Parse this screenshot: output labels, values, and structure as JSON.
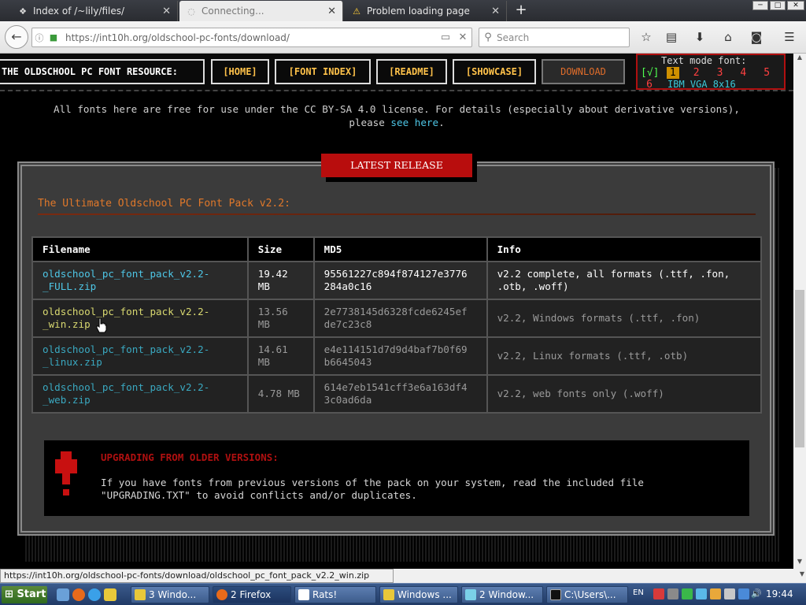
{
  "tabs": [
    {
      "title": "Index of /~lily/files/",
      "icon": "page-icon"
    },
    {
      "title": "Connecting...",
      "icon": "loading-icon"
    },
    {
      "title": "Problem loading page",
      "icon": "warning-icon"
    }
  ],
  "navbar": {
    "url_domain": "https://int10h.org",
    "url_path": "/oldschool-pc-fonts/download/",
    "search_placeholder": "Search"
  },
  "site": {
    "title": "THE OLDSCHOOL PC FONT RESOURCE:",
    "nav": [
      "[HOME]",
      "[FONT INDEX]",
      "[README]",
      "[SHOWCASE]",
      "DOWNLOAD"
    ],
    "font_selector": {
      "label": "Text mode font:",
      "check": "[√]",
      "options": [
        "1",
        "2",
        "3",
        "4",
        "5",
        "6"
      ],
      "current": "IBM VGA 8x16"
    },
    "license_line1": "All fonts here are free for use under the CC BY-SA 4.0 license. For details (especially about derivative versions),",
    "license_line2_prefix": "please ",
    "license_link": "see here",
    "license_line2_suffix": "."
  },
  "release": {
    "badge": "LATEST RELEASE",
    "pack_title": "The Ultimate Oldschool PC Font Pack v2.2:",
    "columns": [
      "Filename",
      "Size",
      "MD5",
      "Info"
    ],
    "rows": [
      {
        "filename_1": "oldschool_pc_font_pack_v2.2-",
        "filename_2": "_FULL.zip",
        "size_1": "19.42",
        "size_2": "MB",
        "md5_1": "95561227c894f874127e3776",
        "md5_2": "284a0c16",
        "info_1": "v2.2 complete, all formats (.ttf, .fon,",
        "info_2": ".otb, .woff)"
      },
      {
        "filename_1": "oldschool_pc_font_pack_v2.2-",
        "filename_2": "_win.zip",
        "size_1": "13.56",
        "size_2": "MB",
        "md5_1": "2e7738145d6328fcde6245ef",
        "md5_2": "de7c23c8",
        "info_1": "v2.2, Windows formats (.ttf, .fon)",
        "info_2": ""
      },
      {
        "filename_1": "oldschool_pc_font_pack_v2.2-",
        "filename_2": "_linux.zip",
        "size_1": "14.61",
        "size_2": "MB",
        "md5_1": "e4e114151d7d9d4baf7b0f69",
        "md5_2": "b6645043",
        "info_1": "v2.2, Linux formats (.ttf, .otb)",
        "info_2": ""
      },
      {
        "filename_1": "oldschool_pc_font_pack_v2.2-",
        "filename_2": "_web.zip",
        "size_1": "4.78 MB",
        "size_2": "",
        "md5_1": "614e7eb1541cff3e6a163df4",
        "md5_2": "3c0ad6da",
        "info_1": "v2.2, web fonts only (.woff)",
        "info_2": ""
      }
    ],
    "upgrade_title": "UPGRADING FROM OLDER VERSIONS:",
    "upgrade_line1": "If you have fonts from previous versions of the pack on your system, read the included file",
    "upgrade_line2": "\"UPGRADING.TXT\" to avoid conflicts and/or duplicates."
  },
  "status_url": "https://int10h.org/oldschool-pc-fonts/download/oldschool_pc_font_pack_v2.2_win.zip",
  "taskbar": {
    "start": "Start",
    "tasks": [
      "3 Windo...",
      "2 Firefox",
      "Rats!",
      "Windows ...",
      "2 Window...",
      "C:\\Users\\..."
    ],
    "lang": "EN",
    "clock": "19:44"
  },
  "colors": {
    "accent_red": "#b80d0d",
    "link_cyan": "#4ec6e6",
    "nav_yellow": "#ffc24a",
    "title_orange": "#e0782a"
  }
}
